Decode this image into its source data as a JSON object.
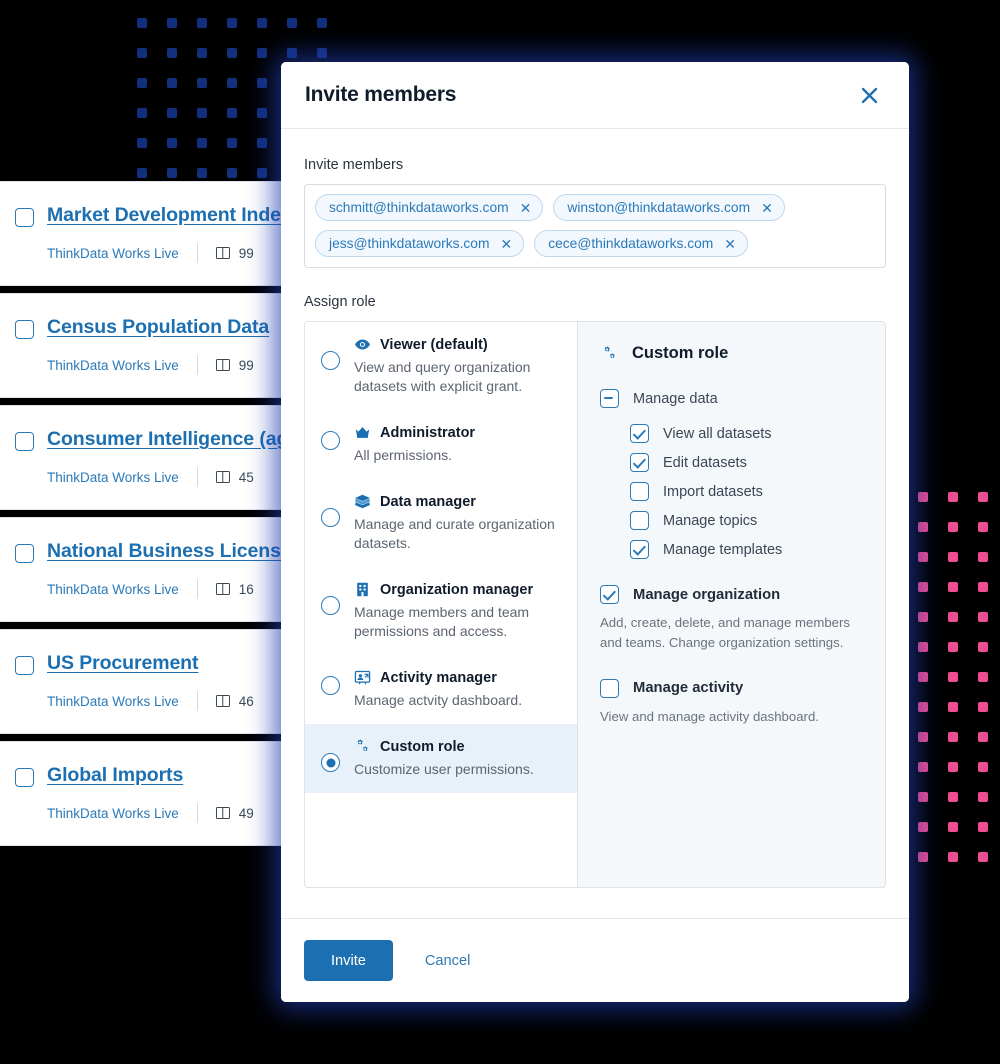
{
  "colors": {
    "dots_blue": "#12307e",
    "dots_pink": "#ef4d91",
    "accent_blue": "#1c6fb0",
    "link_blue": "#2b7ab8",
    "panel_bg": "#f5f8fb",
    "selected_row": "#e8f1f9",
    "background": "#000000"
  },
  "background_cards": [
    {
      "title": "Market Development Index",
      "source": "ThinkData Works Live",
      "columns": "99",
      "checked": false
    },
    {
      "title": "Census Population Data",
      "source": "ThinkData Works Live",
      "columns": "99",
      "checked": false
    },
    {
      "title": "Consumer Intelligence (agg)",
      "source": "ThinkData Works Live",
      "columns": "45",
      "checked": false
    },
    {
      "title": "National Business Licenses",
      "source": "ThinkData Works Live",
      "columns": "16",
      "checked": false
    },
    {
      "title": "US Procurement",
      "source": "ThinkData Works Live",
      "columns": "46",
      "checked": false
    },
    {
      "title": "Global Imports",
      "source": "ThinkData Works Live",
      "columns": "49",
      "checked": false
    }
  ],
  "dialog": {
    "title": "Invite members",
    "close_icon": "close-icon",
    "invite_field": {
      "label": "Invite members",
      "chips": [
        {
          "email": "schmitt@thinkdataworks.com",
          "remove_icon": "close-icon"
        },
        {
          "email": "winston@thinkdataworks.com",
          "remove_icon": "close-icon"
        },
        {
          "email": "jess@thinkdataworks.com",
          "remove_icon": "close-icon"
        },
        {
          "email": "cece@thinkdataworks.com",
          "remove_icon": "close-icon"
        }
      ]
    },
    "assign_role": {
      "label": "Assign role",
      "roles": [
        {
          "name": "Viewer (default)",
          "description": "View and query organization datasets with explicit grant.",
          "icon": "eye-icon",
          "selected": false
        },
        {
          "name": "Administrator",
          "description": "All permissions.",
          "icon": "crown-icon",
          "selected": false
        },
        {
          "name": "Data manager",
          "description": "Manage and curate organization datasets.",
          "icon": "layers-icon",
          "selected": false
        },
        {
          "name": "Organization manager",
          "description": "Manage members and team permissions and access.",
          "icon": "building-icon",
          "selected": false
        },
        {
          "name": "Activity manager",
          "description": "Manage actvity dashboard.",
          "icon": "presentation-user-icon",
          "selected": false
        },
        {
          "name": "Custom role",
          "description": "Customize user permissions.",
          "icon": "gears-icon",
          "selected": true
        }
      ]
    },
    "permissions": {
      "title": "Custom role",
      "title_icon": "gears-icon",
      "group": {
        "label": "Manage data",
        "state": "indeterminate",
        "items": [
          {
            "label": "View all datasets",
            "checked": true
          },
          {
            "label": "Edit datasets",
            "checked": true
          },
          {
            "label": "Import datasets",
            "checked": false
          },
          {
            "label": "Manage topics",
            "checked": false
          },
          {
            "label": "Manage templates",
            "checked": true
          }
        ]
      },
      "sections": [
        {
          "label": "Manage organization",
          "checked": true,
          "description": "Add, create, delete, and manage members and teams. Change organization settings."
        },
        {
          "label": "Manage activity",
          "checked": false,
          "description": "View and manage activity dashboard."
        }
      ]
    },
    "footer": {
      "primary_label": "Invite",
      "secondary_label": "Cancel"
    }
  }
}
